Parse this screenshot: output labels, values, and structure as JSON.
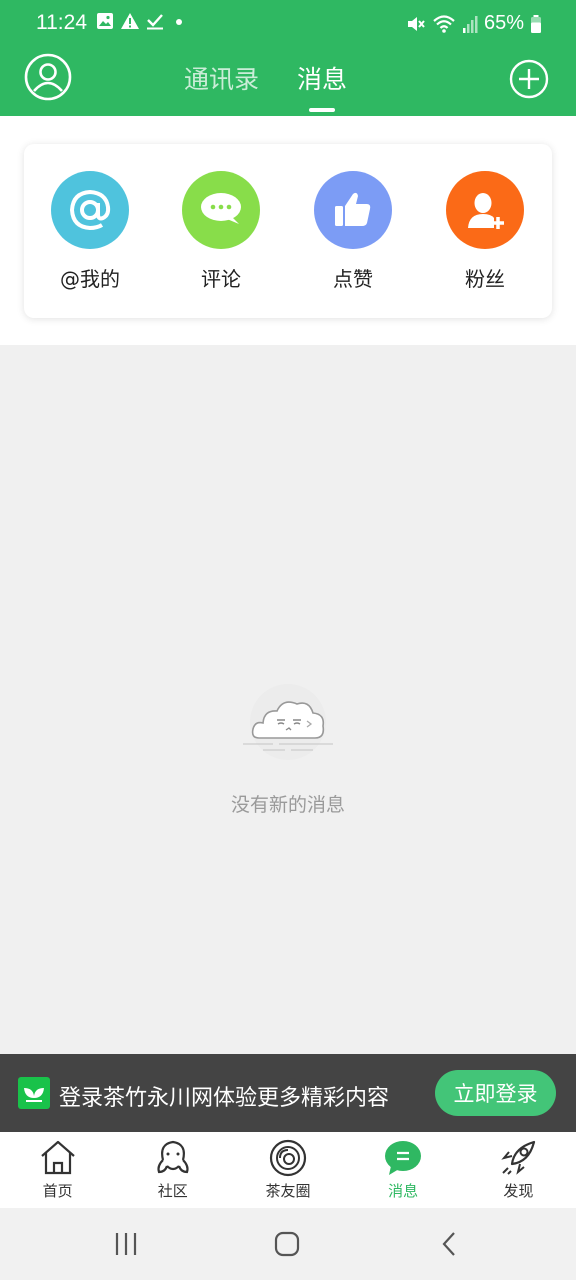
{
  "status_bar": {
    "time": "11:24",
    "battery": "65%",
    "icons_left": [
      "gallery-icon",
      "warning-icon",
      "check-icon",
      "dot-icon"
    ],
    "icons_right": [
      "mute-icon",
      "wifi-icon",
      "signal-icon",
      "battery-icon"
    ]
  },
  "header": {
    "tabs": [
      {
        "label": "通讯录",
        "active": false
      },
      {
        "label": "消息",
        "active": true
      }
    ],
    "left_icon": "user-icon",
    "right_icon": "plus-circle-icon"
  },
  "categories": [
    {
      "label": "@我的",
      "icon": "at-icon",
      "color": "#4fc3dd"
    },
    {
      "label": "评论",
      "icon": "comment-icon",
      "color": "#88dd4a"
    },
    {
      "label": "点赞",
      "icon": "thumbs-up-icon",
      "color": "#7c9cf5"
    },
    {
      "label": "粉丝",
      "icon": "add-user-icon",
      "color": "#fb6a17"
    }
  ],
  "empty_state": {
    "text": "没有新的消息",
    "icon": "cloud-icon"
  },
  "banner": {
    "text": "登录茶竹永川网体验更多精彩内容",
    "button": "立即登录",
    "icon": "app-logo-icon"
  },
  "nav": [
    {
      "label": "首页",
      "icon": "home-icon",
      "active": false
    },
    {
      "label": "社区",
      "icon": "community-icon",
      "active": false
    },
    {
      "label": "茶友圈",
      "icon": "circle-icon",
      "active": false
    },
    {
      "label": "消息",
      "icon": "message-icon",
      "active": true
    },
    {
      "label": "发现",
      "icon": "rocket-icon",
      "active": false
    }
  ],
  "colors": {
    "brand": "#2fb862",
    "banner_bg": "#444444",
    "login_button": "#43c578"
  }
}
